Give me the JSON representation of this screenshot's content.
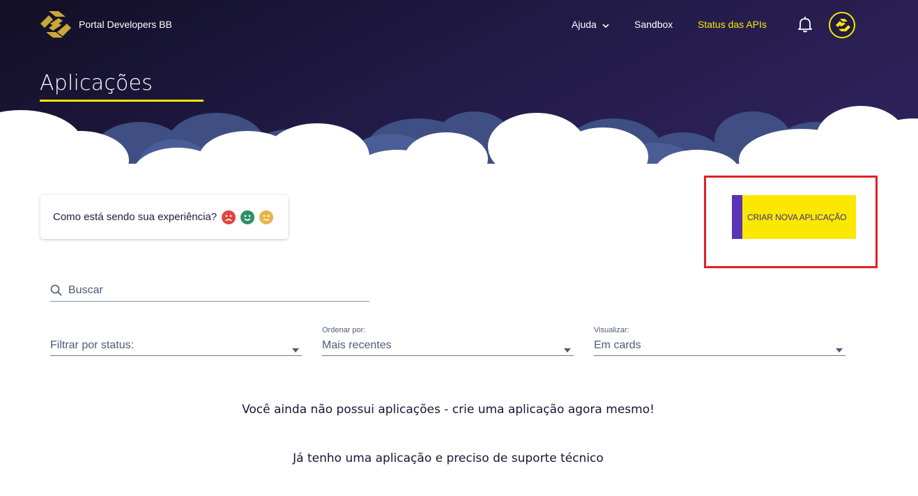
{
  "header": {
    "brand": "Portal Developers BB",
    "nav": {
      "help": "Ajuda",
      "sandbox": "Sandbox",
      "status": "Status das APIs"
    },
    "icons": [
      "bb-logo-icon",
      "chevron-down-icon",
      "bell-icon",
      "bb-avatar-icon"
    ]
  },
  "page": {
    "title": "Aplicações"
  },
  "feedback": {
    "question": "Como está sendo sua experiência?",
    "faces": [
      "sad-face-icon",
      "happy-face-icon",
      "neutral-face-icon"
    ]
  },
  "actions": {
    "create_label": "CRIAR NOVA APLICAÇÃO"
  },
  "search": {
    "placeholder": "Buscar"
  },
  "filters": {
    "status": {
      "value": "Filtrar por status:"
    },
    "order": {
      "label": "Ordenar por:",
      "value": "Mais recentes"
    },
    "view": {
      "label": "Visualizar:",
      "value": "Em cards"
    }
  },
  "content": {
    "empty_message": "Você ainda não possui aplicações - crie uma aplicação agora mesmo!",
    "support_link": "Já tenho uma aplicação e preciso de suporte técnico"
  },
  "colors": {
    "header_bg": "#1b1636",
    "accent_yellow": "#fce700",
    "accent_purple": "#5b34b6",
    "highlight_red": "#e31f26",
    "text_dark": "#141635"
  }
}
